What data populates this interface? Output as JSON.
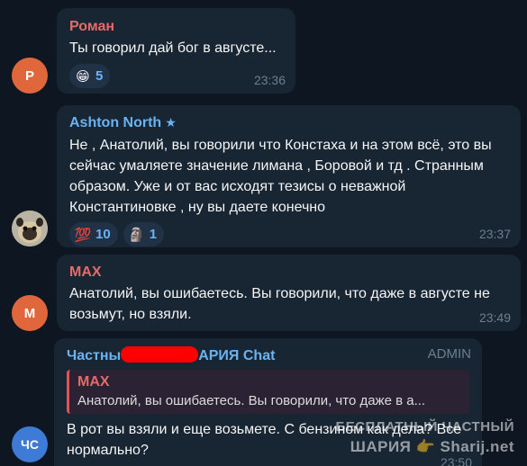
{
  "messages": [
    {
      "sender": "Роман",
      "sender_color": "#e56b6b",
      "avatar_initials": "Р",
      "avatar_color": "#e0673c",
      "text": "Ты говорил дай бог в августе...",
      "reactions": [
        {
          "emoji": "😁",
          "emoji_name": "grinning-face-icon",
          "count": "5"
        }
      ],
      "time": "23:36"
    },
    {
      "sender": "Ashton North",
      "sender_color": "#6ab3f3",
      "star": "★",
      "avatar_initials": "",
      "text": "Не , Анатолий, вы говорили что Констаха и на этом всё, это вы сейчас умаляете значение лимана , Боровой и тд . Странным образом. Уже и от вас исходят тезисы о неважной Константиновке , ну вы даете конечно",
      "reactions": [
        {
          "emoji": "💯",
          "emoji_name": "hundred-points-icon",
          "count": "10"
        },
        {
          "emoji": "🗿",
          "emoji_name": "moai-icon",
          "count": "1"
        }
      ],
      "time": "23:37"
    },
    {
      "sender": "MAX",
      "sender_color": "#e56b6b",
      "avatar_initials": "M",
      "avatar_color": "#e0673c",
      "text": "Анатолий, вы ошибаетесь. Вы говорили, что даже в августе не возьмут, но взяли.",
      "time": "23:49"
    },
    {
      "sender_prefix": "Частны",
      "sender_suffix": "АРИЯ Chat",
      "sender_color": "#6ab3f3",
      "badge": "ADMIN",
      "avatar_initials": "ЧС",
      "avatar_color": "#3e7bd6",
      "reply": {
        "name": "MAX",
        "text": "Анатолий, вы ошибаетесь. Вы говорили, что даже в а..."
      },
      "text": "В рот вы взяли и еще возьмете. С бензином как дела? Все нормально?",
      "time": "23:50"
    }
  ],
  "watermark": {
    "line1": "БЕСПЛАТНЫЙ ЧАСТНЫЙ",
    "line2_left": "ШАРИЯ",
    "hand": "👉",
    "line2_right": "Sharij.net"
  }
}
